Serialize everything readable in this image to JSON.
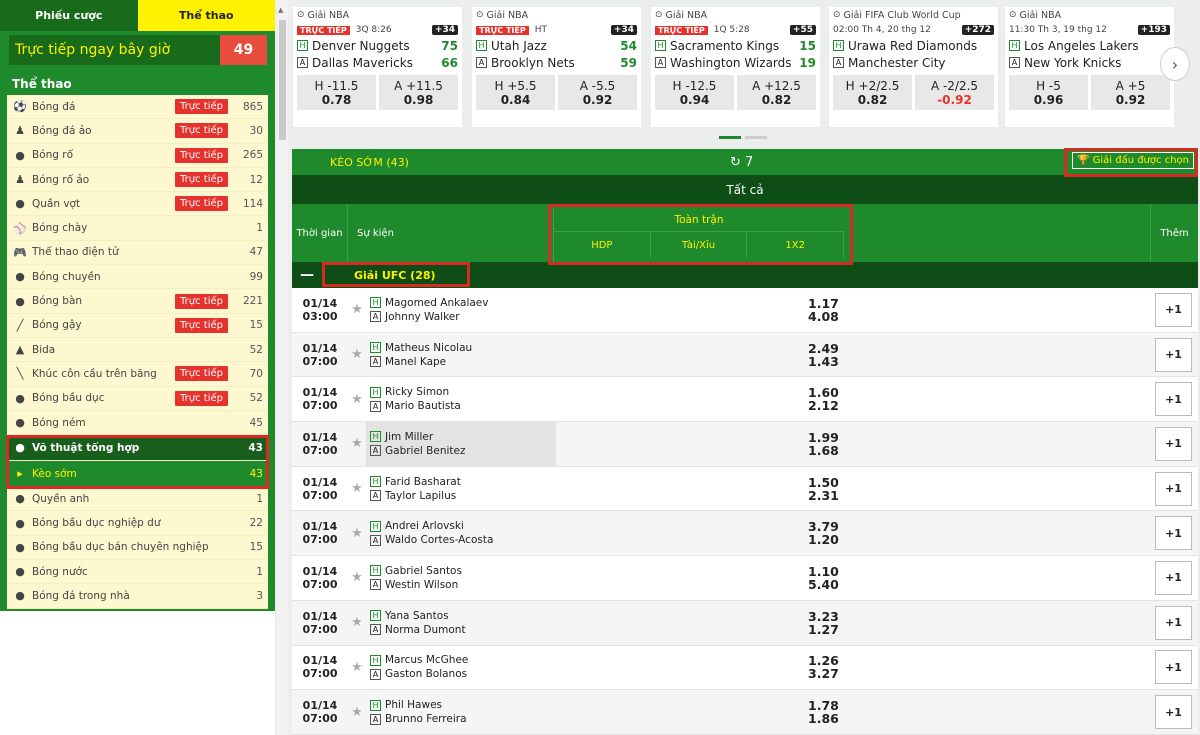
{
  "sidebar": {
    "tabs": [
      "Phiếu cược",
      "Thể thao"
    ],
    "live_now_label": "Trực tiếp ngay bây giờ",
    "live_now_count": "49",
    "sports_title": "Thể thao",
    "live_badge": "Trực tiếp",
    "items": [
      {
        "icon": "soccer-ball-icon",
        "glyph": "⚽",
        "label": "Bóng đá",
        "live": true,
        "count": "865"
      },
      {
        "icon": "virtual-soccer-icon",
        "glyph": "♟",
        "label": "Bóng đá ảo",
        "live": true,
        "count": "30"
      },
      {
        "icon": "basketball-icon",
        "glyph": "●",
        "label": "Bóng rổ",
        "live": true,
        "count": "265"
      },
      {
        "icon": "virtual-basketball-icon",
        "glyph": "♟",
        "label": "Bóng rổ ảo",
        "live": true,
        "count": "12"
      },
      {
        "icon": "tennis-ball-icon",
        "glyph": "●",
        "label": "Quần vợt",
        "live": true,
        "count": "114"
      },
      {
        "icon": "baseball-icon",
        "glyph": "⚾",
        "label": "Bóng chày",
        "live": false,
        "count": "1"
      },
      {
        "icon": "gamepad-icon",
        "glyph": "🎮",
        "label": "Thể thao điện tử",
        "live": false,
        "count": "47"
      },
      {
        "icon": "volleyball-icon",
        "glyph": "●",
        "label": "Bóng chuyền",
        "live": false,
        "count": "99"
      },
      {
        "icon": "table-tennis-icon",
        "glyph": "●",
        "label": "Bóng bàn",
        "live": true,
        "count": "221"
      },
      {
        "icon": "cricket-bat-icon",
        "glyph": "╱",
        "label": "Bóng gậy",
        "live": true,
        "count": "15"
      },
      {
        "icon": "billiards-icon",
        "glyph": "▲",
        "label": "Bida",
        "live": false,
        "count": "52"
      },
      {
        "icon": "ice-hockey-icon",
        "glyph": "╲",
        "label": "Khúc côn cầu trên băng",
        "live": true,
        "count": "70"
      },
      {
        "icon": "rugby-ball-icon",
        "glyph": "●",
        "label": "Bóng bầu dục",
        "live": true,
        "count": "52"
      },
      {
        "icon": "handball-icon",
        "glyph": "●",
        "label": "Bóng ném",
        "live": false,
        "count": "45"
      }
    ],
    "active_item": {
      "icon": "martial-arts-icon",
      "glyph": "●",
      "label": "Võ thuật tổng hợp",
      "count": "43"
    },
    "sub_item": {
      "label": "Kèo sớm",
      "count": "43"
    },
    "items_after": [
      {
        "icon": "boxing-glove-icon",
        "glyph": "●",
        "label": "Quyền anh",
        "count": "1"
      },
      {
        "icon": "american-football-icon",
        "glyph": "●",
        "label": "Bóng bầu dục nghiệp dư",
        "count": "22"
      },
      {
        "icon": "semi-pro-football-icon",
        "glyph": "●",
        "label": "Bóng bầu dục bán chuyên nghiệp",
        "count": "15"
      },
      {
        "icon": "water-polo-icon",
        "glyph": "●",
        "label": "Bóng nước",
        "count": "1"
      },
      {
        "icon": "futsal-icon",
        "glyph": "●",
        "label": "Bóng đá trong nhà",
        "count": "3"
      }
    ]
  },
  "cards": [
    {
      "league": "Giải NBA",
      "live": true,
      "live_label": "TRỰC TIẾP",
      "status": "3Q 8:26",
      "plus": "+34",
      "home": "Denver Nuggets",
      "away": "Dallas Mavericks",
      "home_score": "75",
      "away_score": "66",
      "odds_l_top": "H -11.5",
      "odds_l_val": "0.78",
      "odds_r_top": "A +11.5",
      "odds_r_val": "0.98",
      "r_neg": false
    },
    {
      "league": "Giải NBA",
      "live": true,
      "live_label": "TRỰC TIẾP",
      "status": "HT",
      "plus": "+34",
      "home": "Utah Jazz",
      "away": "Brooklyn Nets",
      "home_score": "54",
      "away_score": "59",
      "odds_l_top": "H +5.5",
      "odds_l_val": "0.84",
      "odds_r_top": "A -5.5",
      "odds_r_val": "0.92",
      "r_neg": false
    },
    {
      "league": "Giải NBA",
      "live": true,
      "live_label": "TRỰC TIẾP",
      "status": "1Q 5:28",
      "plus": "+55",
      "home": "Sacramento Kings",
      "away": "Washington Wizards",
      "home_score": "15",
      "away_score": "19",
      "odds_l_top": "H -12.5",
      "odds_l_val": "0.94",
      "odds_r_top": "A +12.5",
      "odds_r_val": "0.82",
      "r_neg": false
    },
    {
      "league": "Giải FIFA Club World Cup",
      "live": false,
      "live_label": "",
      "status": "02:00 Th 4, 20 thg 12",
      "plus": "+272",
      "home": "Urawa Red Diamonds",
      "away": "Manchester City",
      "home_score": "",
      "away_score": "",
      "odds_l_top": "H +2/2.5",
      "odds_l_val": "0.82",
      "odds_r_top": "A -2/2.5",
      "odds_r_val": "-0.92",
      "r_neg": true
    },
    {
      "league": "Giải NBA",
      "live": false,
      "live_label": "",
      "status": "11:30 Th 3, 19 thg 12",
      "plus": "+193",
      "home": "Los Angeles Lakers",
      "away": "New York Knicks",
      "home_score": "",
      "away_score": "",
      "odds_l_top": "H -5",
      "odds_l_val": "0.96",
      "odds_r_top": "A +5",
      "odds_r_val": "0.92",
      "r_neg": false
    }
  ],
  "main": {
    "early_label": "KÈO SỚM (43)",
    "refresh_count": "7",
    "tournament_button": "Giải đấu được chọn",
    "all_label": "Tất cả",
    "col_time": "Thời gian",
    "col_event": "Sự kiện",
    "col_full": "Toàn trận",
    "col_hdp": "HDP",
    "col_ou": "Tài/Xỉu",
    "col_1x2": "1X2",
    "col_more": "Thêm",
    "league_name": "Giải UFC (28)",
    "home_tag": "H",
    "away_tag": "A",
    "more_label": "+1"
  },
  "matches": [
    {
      "date": "01/14",
      "time": "03:00",
      "home": "Magomed Ankalaev",
      "away": "Johnny Walker",
      "o1": "1.17",
      "o2": "4.08"
    },
    {
      "date": "01/14",
      "time": "07:00",
      "home": "Matheus Nicolau",
      "away": "Manel Kape",
      "o1": "2.49",
      "o2": "1.43"
    },
    {
      "date": "01/14",
      "time": "07:00",
      "home": "Ricky Simon",
      "away": "Mario Bautista",
      "o1": "1.60",
      "o2": "2.12"
    },
    {
      "date": "01/14",
      "time": "07:00",
      "home": "Jim Miller",
      "away": "Gabriel Benitez",
      "o1": "1.99",
      "o2": "1.68"
    },
    {
      "date": "01/14",
      "time": "07:00",
      "home": "Farid Basharat",
      "away": "Taylor Lapilus",
      "o1": "1.50",
      "o2": "2.31"
    },
    {
      "date": "01/14",
      "time": "07:00",
      "home": "Andrei Arlovski",
      "away": "Waldo Cortes-Acosta",
      "o1": "3.79",
      "o2": "1.20"
    },
    {
      "date": "01/14",
      "time": "07:00",
      "home": "Gabriel Santos",
      "away": "Westin Wilson",
      "o1": "1.10",
      "o2": "5.40"
    },
    {
      "date": "01/14",
      "time": "07:00",
      "home": "Yana Santos",
      "away": "Norma Dumont",
      "o1": "3.23",
      "o2": "1.27"
    },
    {
      "date": "01/14",
      "time": "07:00",
      "home": "Marcus McGhee",
      "away": "Gaston Bolanos",
      "o1": "1.26",
      "o2": "3.27"
    },
    {
      "date": "01/14",
      "time": "07:00",
      "home": "Phil Hawes",
      "away": "Brunno Ferreira",
      "o1": "1.78",
      "o2": "1.86"
    }
  ]
}
